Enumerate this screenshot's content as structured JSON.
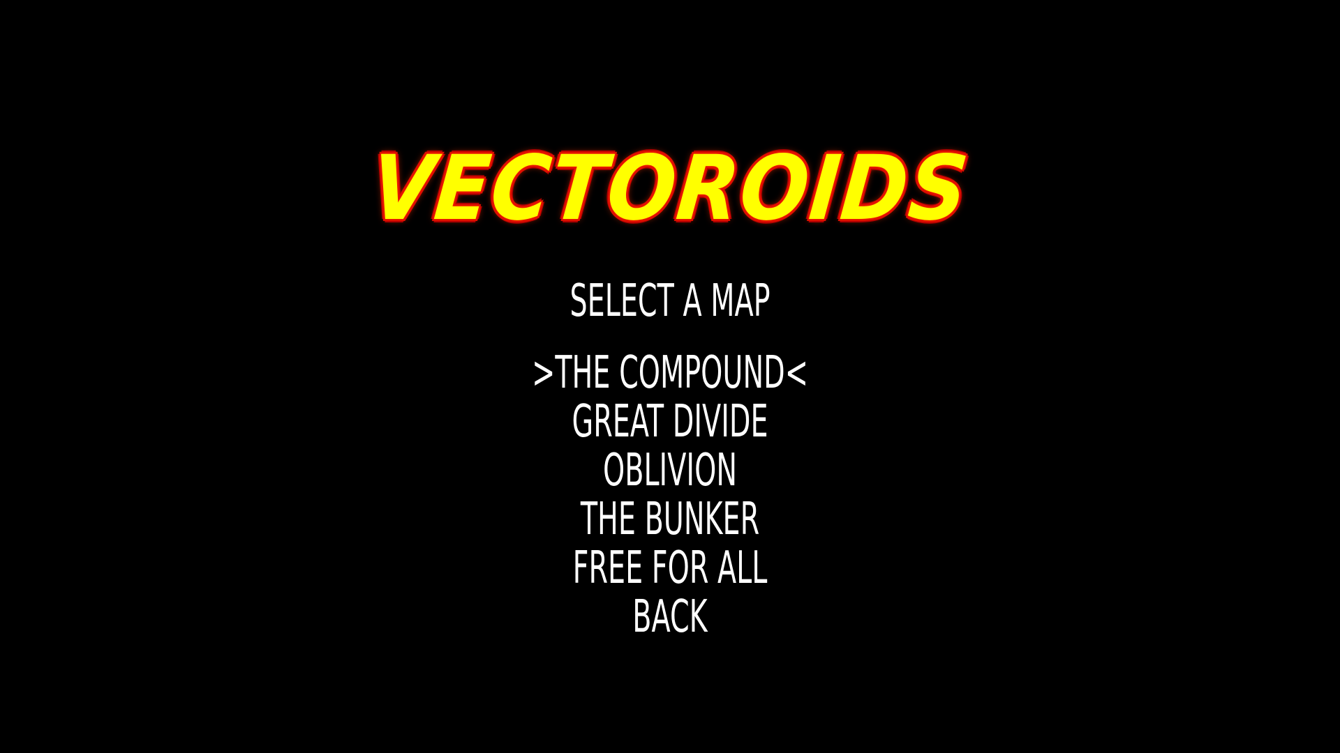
{
  "game": {
    "title": "VECTOROIDS",
    "subtitle": "SELECT A MAP"
  },
  "menu": {
    "selected_index": 0,
    "selection_prefix": ">",
    "selection_suffix": "<",
    "items": [
      {
        "label": "THE COMPOUND"
      },
      {
        "label": "GREAT DIVIDE"
      },
      {
        "label": "OBLIVION"
      },
      {
        "label": "THE BUNKER"
      },
      {
        "label": "FREE FOR ALL"
      },
      {
        "label": "BACK"
      }
    ]
  },
  "colors": {
    "background": "#000000",
    "title_fill": "#ffff00",
    "title_outline": "#e01000",
    "menu_text": "#ffffff"
  }
}
